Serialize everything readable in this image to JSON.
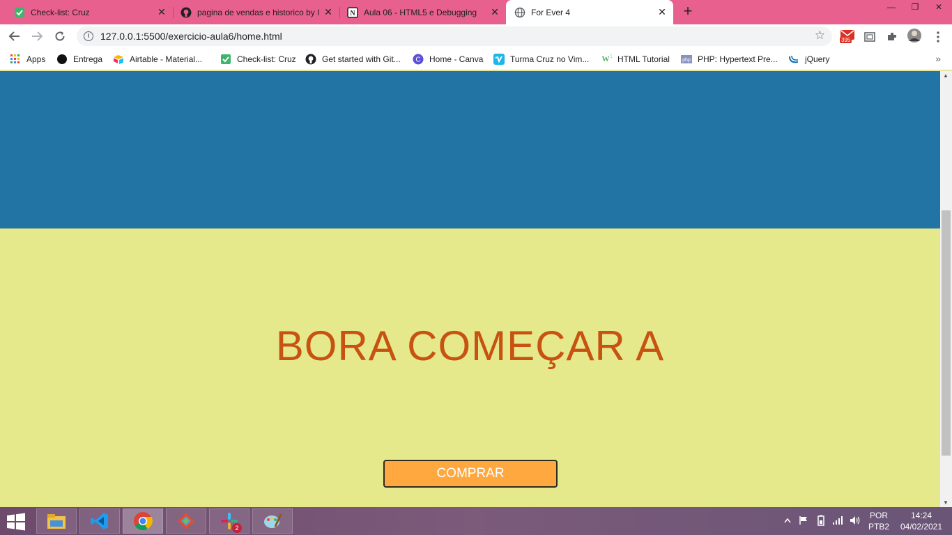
{
  "browser": {
    "tabs": [
      {
        "label": "Check-list: Cruz",
        "icon": "check-icon",
        "active": false
      },
      {
        "label": "pagina de vendas e historico by I",
        "icon": "github-icon",
        "active": false
      },
      {
        "label": "Aula 06 - HTML5 e Debugging",
        "icon": "notion-icon",
        "active": false
      },
      {
        "label": "For Ever 4",
        "icon": "globe-icon",
        "active": true
      }
    ],
    "new_tab_symbol": "+",
    "url": "127.0.0.1:5500/exercicio-aula6/home.html",
    "gmail_badge": "395",
    "bookmarks": [
      {
        "label": "Apps",
        "icon": "apps-grid-icon"
      },
      {
        "label": "Entrega",
        "icon": "black-dot-icon"
      },
      {
        "label": "Airtable - Material...",
        "icon": "airtable-icon"
      },
      {
        "label": "Check-list: Cruz",
        "icon": "check-icon"
      },
      {
        "label": "Get started with Git...",
        "icon": "github-icon"
      },
      {
        "label": "Home - Canva",
        "icon": "canva-icon"
      },
      {
        "label": "Turma Cruz no Vim...",
        "icon": "vimeo-icon"
      },
      {
        "label": "HTML Tutorial",
        "icon": "w3schools-icon"
      },
      {
        "label": "PHP: Hypertext Pre...",
        "icon": "php-icon"
      },
      {
        "label": "jQuery",
        "icon": "jquery-icon"
      }
    ],
    "bookmarks_more": "»"
  },
  "page": {
    "headline": "BORA COMEÇAR A",
    "buy_button": "COMPRAR",
    "colors": {
      "hero_blue": "#2274a5",
      "section_yellow": "#e5e98c",
      "headline_orange": "#c75211",
      "button_orange": "#ffa83f"
    }
  },
  "taskbar": {
    "apps": [
      "file-explorer-icon",
      "vscode-icon",
      "chrome-icon",
      "git-icon",
      "slack-icon",
      "paint-icon"
    ],
    "slack_badge": "2",
    "language_top": "POR",
    "language_bottom": "PTB2",
    "time": "14:24",
    "date": "04/02/2021"
  }
}
